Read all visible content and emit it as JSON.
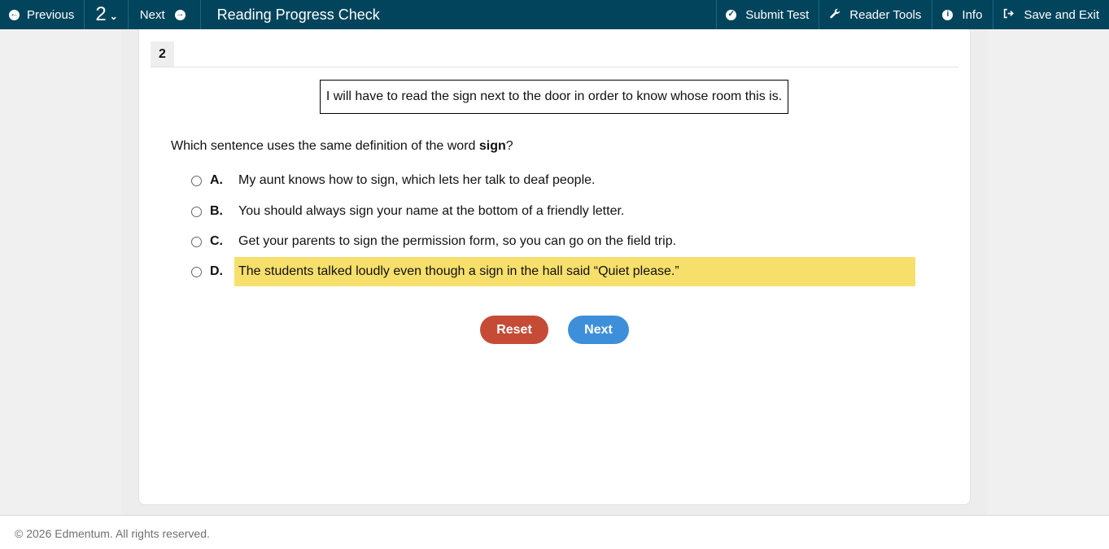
{
  "toolbar": {
    "previous_label": "Previous",
    "question_number": "2",
    "next_label": "Next",
    "test_title": "Reading Progress Check",
    "submit_label": "Submit Test",
    "reader_tools_label": "Reader Tools",
    "info_label": "Info",
    "save_exit_label": "Save and Exit",
    "icons": {
      "previous": "arrow-left-circle-icon",
      "question_menu": "chevron-down-icon",
      "next": "arrow-right-circle-icon",
      "submit": "check-circle-icon",
      "reader_tools": "wrench-icon",
      "info": "info-icon",
      "save_exit": "sign-out-icon"
    },
    "colors": {
      "background": "#02445c"
    }
  },
  "question": {
    "tab_number": "2",
    "passage": "I will have to read the sign next to the door in order to know whose room this is.",
    "prompt_before": "Which sentence uses the same definition of the word ",
    "prompt_keyword": "sign",
    "prompt_after": "?",
    "choices": [
      {
        "letter": "A.",
        "text": "My aunt knows how to sign, which lets her talk to deaf people.",
        "highlighted": false
      },
      {
        "letter": "B.",
        "text": "You should always sign your name at the bottom of a friendly letter.",
        "highlighted": false
      },
      {
        "letter": "C.",
        "text": "Get your parents to sign the permission form, so you can go on the field trip.",
        "highlighted": false
      },
      {
        "letter": "D.",
        "text": "The students talked loudly even though a sign in the hall said “Quiet please.”",
        "highlighted": true
      }
    ],
    "highlight_color": "#f7df6c"
  },
  "buttons": {
    "reset_label": "Reset",
    "next_label": "Next",
    "reset_color": "#c54b37",
    "next_color": "#3d8fd9"
  },
  "footer": {
    "copyright": "© 2026 Edmentum. All rights reserved."
  }
}
